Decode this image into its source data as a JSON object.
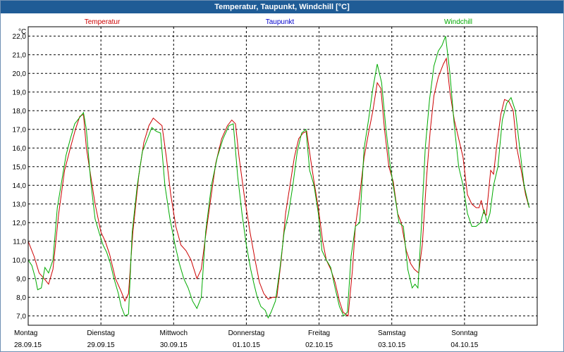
{
  "window": {
    "title": "Temperatur, Taupunkt, Windchill [°C]"
  },
  "colors": {
    "title_bar": "#1f5c96",
    "temperatur": "#cc0000",
    "taupunkt": "#0000cc",
    "windchill": "#00aa00",
    "grid": "#000000"
  },
  "chart_data": {
    "type": "line",
    "title": "Temperatur, Taupunkt, Windchill [°C]",
    "y_unit": "°C",
    "ylim": [
      6.5,
      22.5
    ],
    "y_ticks": [
      "7,0",
      "8,0",
      "9,0",
      "10,0",
      "11,0",
      "12,0",
      "13,0",
      "14,0",
      "15,0",
      "16,0",
      "17,0",
      "18,0",
      "19,0",
      "20,0",
      "21,0",
      "22,0"
    ],
    "y_tick_values": [
      7,
      8,
      9,
      10,
      11,
      12,
      13,
      14,
      15,
      16,
      17,
      18,
      19,
      20,
      21,
      22
    ],
    "xlim": [
      0,
      7.0
    ],
    "x_ticks": [
      {
        "day": "Montag",
        "date": "28.09.15"
      },
      {
        "day": "Dienstag",
        "date": "29.09.15"
      },
      {
        "day": "Mittwoch",
        "date": "30.09.15"
      },
      {
        "day": "Donnerstag",
        "date": "01.10.15"
      },
      {
        "day": "Freitag",
        "date": "02.10.15"
      },
      {
        "day": "Samstag",
        "date": "03.10.15"
      },
      {
        "day": "Sonntag",
        "date": "04.10.15"
      }
    ],
    "legend": [
      "Temperatur",
      "Taupunkt",
      "Windchill"
    ],
    "grid": true,
    "series": [
      {
        "name": "Temperatur",
        "color": "#cc0000",
        "points": [
          [
            0.0,
            11.0
          ],
          [
            0.08,
            10.2
          ],
          [
            0.15,
            9.3
          ],
          [
            0.22,
            9.0
          ],
          [
            0.28,
            8.7
          ],
          [
            0.34,
            9.5
          ],
          [
            0.42,
            12.5
          ],
          [
            0.5,
            14.8
          ],
          [
            0.58,
            16.0
          ],
          [
            0.65,
            17.0
          ],
          [
            0.71,
            17.7
          ],
          [
            0.76,
            17.8
          ],
          [
            0.8,
            16.0
          ],
          [
            0.86,
            14.5
          ],
          [
            0.92,
            13.0
          ],
          [
            1.0,
            11.5
          ],
          [
            1.06,
            11.0
          ],
          [
            1.12,
            10.3
          ],
          [
            1.2,
            9.0
          ],
          [
            1.28,
            8.3
          ],
          [
            1.33,
            7.8
          ],
          [
            1.38,
            8.2
          ],
          [
            1.44,
            11.5
          ],
          [
            1.52,
            14.5
          ],
          [
            1.59,
            16.3
          ],
          [
            1.66,
            17.2
          ],
          [
            1.72,
            17.6
          ],
          [
            1.78,
            17.4
          ],
          [
            1.84,
            17.2
          ],
          [
            1.9,
            15.5
          ],
          [
            1.96,
            13.5
          ],
          [
            2.03,
            11.8
          ],
          [
            2.1,
            10.8
          ],
          [
            2.17,
            10.5
          ],
          [
            2.24,
            10.0
          ],
          [
            2.32,
            9.0
          ],
          [
            2.38,
            9.5
          ],
          [
            2.43,
            11.0
          ],
          [
            2.5,
            13.0
          ],
          [
            2.58,
            15.2
          ],
          [
            2.66,
            16.5
          ],
          [
            2.74,
            17.2
          ],
          [
            2.8,
            17.5
          ],
          [
            2.85,
            17.3
          ],
          [
            2.9,
            15.5
          ],
          [
            2.97,
            13.5
          ],
          [
            3.05,
            11.5
          ],
          [
            3.12,
            10.0
          ],
          [
            3.18,
            8.8
          ],
          [
            3.24,
            8.2
          ],
          [
            3.3,
            7.9
          ],
          [
            3.36,
            8.0
          ],
          [
            3.42,
            8.0
          ],
          [
            3.48,
            10.0
          ],
          [
            3.54,
            12.5
          ],
          [
            3.6,
            14.0
          ],
          [
            3.66,
            15.5
          ],
          [
            3.72,
            16.5
          ],
          [
            3.78,
            16.8
          ],
          [
            3.83,
            16.9
          ],
          [
            3.88,
            15.5
          ],
          [
            3.93,
            14.2
          ],
          [
            3.99,
            12.8
          ],
          [
            4.05,
            11.0
          ],
          [
            4.1,
            10.0
          ],
          [
            4.16,
            9.5
          ],
          [
            4.22,
            8.8
          ],
          [
            4.28,
            7.8
          ],
          [
            4.33,
            7.2
          ],
          [
            4.4,
            7.0
          ],
          [
            4.46,
            9.5
          ],
          [
            4.5,
            11.8
          ],
          [
            4.56,
            13.5
          ],
          [
            4.62,
            15.5
          ],
          [
            4.68,
            16.8
          ],
          [
            4.74,
            18.0
          ],
          [
            4.8,
            19.5
          ],
          [
            4.85,
            19.2
          ],
          [
            4.9,
            17.0
          ],
          [
            4.96,
            15.0
          ],
          [
            5.02,
            14.2
          ],
          [
            5.08,
            12.5
          ],
          [
            5.13,
            12.0
          ],
          [
            5.2,
            10.5
          ],
          [
            5.26,
            9.8
          ],
          [
            5.31,
            9.5
          ],
          [
            5.37,
            9.3
          ],
          [
            5.42,
            10.8
          ],
          [
            5.48,
            14.5
          ],
          [
            5.53,
            17.0
          ],
          [
            5.58,
            18.8
          ],
          [
            5.64,
            19.8
          ],
          [
            5.71,
            20.5
          ],
          [
            5.75,
            20.8
          ],
          [
            5.8,
            19.0
          ],
          [
            5.86,
            17.5
          ],
          [
            5.92,
            16.5
          ],
          [
            5.98,
            15.5
          ],
          [
            6.04,
            13.5
          ],
          [
            6.1,
            13.0
          ],
          [
            6.16,
            12.8
          ],
          [
            6.2,
            12.8
          ],
          [
            6.23,
            13.2
          ],
          [
            6.27,
            12.5
          ],
          [
            6.3,
            12.4
          ],
          [
            6.36,
            14.8
          ],
          [
            6.4,
            14.6
          ],
          [
            6.44,
            16.0
          ],
          [
            6.5,
            17.8
          ],
          [
            6.55,
            18.6
          ],
          [
            6.61,
            18.5
          ],
          [
            6.67,
            18.0
          ],
          [
            6.72,
            16.0
          ],
          [
            6.78,
            14.8
          ],
          [
            6.84,
            13.5
          ],
          [
            6.89,
            12.8
          ]
        ]
      },
      {
        "name": "Windchill",
        "color": "#00aa00",
        "points": [
          [
            0.0,
            10.0
          ],
          [
            0.05,
            9.7
          ],
          [
            0.1,
            9.0
          ],
          [
            0.13,
            8.4
          ],
          [
            0.18,
            8.5
          ],
          [
            0.23,
            9.6
          ],
          [
            0.28,
            9.3
          ],
          [
            0.34,
            10.0
          ],
          [
            0.4,
            12.8
          ],
          [
            0.46,
            14.2
          ],
          [
            0.52,
            15.6
          ],
          [
            0.58,
            16.5
          ],
          [
            0.64,
            17.3
          ],
          [
            0.7,
            17.6
          ],
          [
            0.76,
            17.9
          ],
          [
            0.8,
            17.0
          ],
          [
            0.86,
            14.2
          ],
          [
            0.92,
            12.2
          ],
          [
            0.98,
            11.4
          ],
          [
            1.03,
            10.8
          ],
          [
            1.08,
            10.4
          ],
          [
            1.13,
            9.8
          ],
          [
            1.18,
            9.0
          ],
          [
            1.24,
            8.2
          ],
          [
            1.28,
            7.5
          ],
          [
            1.33,
            7.0
          ],
          [
            1.38,
            7.1
          ],
          [
            1.43,
            11.5
          ],
          [
            1.5,
            14.0
          ],
          [
            1.57,
            15.8
          ],
          [
            1.64,
            16.5
          ],
          [
            1.7,
            17.1
          ],
          [
            1.76,
            16.9
          ],
          [
            1.82,
            16.8
          ],
          [
            1.88,
            14.0
          ],
          [
            1.95,
            12.2
          ],
          [
            2.02,
            10.8
          ],
          [
            2.08,
            9.8
          ],
          [
            2.14,
            9.0
          ],
          [
            2.2,
            8.5
          ],
          [
            2.26,
            7.8
          ],
          [
            2.32,
            7.4
          ],
          [
            2.38,
            8.0
          ],
          [
            2.44,
            11.5
          ],
          [
            2.52,
            14.0
          ],
          [
            2.6,
            15.5
          ],
          [
            2.68,
            16.5
          ],
          [
            2.76,
            17.2
          ],
          [
            2.82,
            17.3
          ],
          [
            2.88,
            14.5
          ],
          [
            2.94,
            12.5
          ],
          [
            3.0,
            10.8
          ],
          [
            3.06,
            9.5
          ],
          [
            3.1,
            8.8
          ],
          [
            3.15,
            8.0
          ],
          [
            3.2,
            7.5
          ],
          [
            3.26,
            7.3
          ],
          [
            3.3,
            6.9
          ],
          [
            3.34,
            7.2
          ],
          [
            3.4,
            7.8
          ],
          [
            3.46,
            9.5
          ],
          [
            3.52,
            11.5
          ],
          [
            3.58,
            12.5
          ],
          [
            3.64,
            14.0
          ],
          [
            3.7,
            15.8
          ],
          [
            3.76,
            16.8
          ],
          [
            3.82,
            17.0
          ],
          [
            3.87,
            14.8
          ],
          [
            3.93,
            14.0
          ],
          [
            3.99,
            12.5
          ],
          [
            4.04,
            10.5
          ],
          [
            4.1,
            10.0
          ],
          [
            4.16,
            9.6
          ],
          [
            4.22,
            8.5
          ],
          [
            4.28,
            7.5
          ],
          [
            4.34,
            7.0
          ],
          [
            4.39,
            7.2
          ],
          [
            4.44,
            10.2
          ],
          [
            4.5,
            11.8
          ],
          [
            4.56,
            12.0
          ],
          [
            4.62,
            16.0
          ],
          [
            4.68,
            17.5
          ],
          [
            4.74,
            19.2
          ],
          [
            4.8,
            20.5
          ],
          [
            4.86,
            19.5
          ],
          [
            4.92,
            17.0
          ],
          [
            4.98,
            15.0
          ],
          [
            5.04,
            13.5
          ],
          [
            5.1,
            12.0
          ],
          [
            5.16,
            11.8
          ],
          [
            5.22,
            9.5
          ],
          [
            5.28,
            8.5
          ],
          [
            5.32,
            8.7
          ],
          [
            5.36,
            8.5
          ],
          [
            5.41,
            12.0
          ],
          [
            5.46,
            16.0
          ],
          [
            5.52,
            18.6
          ],
          [
            5.58,
            20.4
          ],
          [
            5.64,
            21.2
          ],
          [
            5.69,
            21.5
          ],
          [
            5.74,
            22.0
          ],
          [
            5.8,
            20.0
          ],
          [
            5.86,
            17.2
          ],
          [
            5.92,
            15.0
          ],
          [
            5.98,
            14.0
          ],
          [
            6.04,
            12.5
          ],
          [
            6.1,
            11.8
          ],
          [
            6.16,
            11.8
          ],
          [
            6.22,
            12.0
          ],
          [
            6.27,
            12.7
          ],
          [
            6.31,
            12.0
          ],
          [
            6.35,
            12.5
          ],
          [
            6.4,
            14.0
          ],
          [
            6.46,
            15.0
          ],
          [
            6.52,
            17.5
          ],
          [
            6.58,
            18.4
          ],
          [
            6.64,
            18.7
          ],
          [
            6.7,
            18.0
          ],
          [
            6.76,
            16.0
          ],
          [
            6.82,
            14.0
          ],
          [
            6.89,
            12.8
          ]
        ]
      }
    ]
  }
}
